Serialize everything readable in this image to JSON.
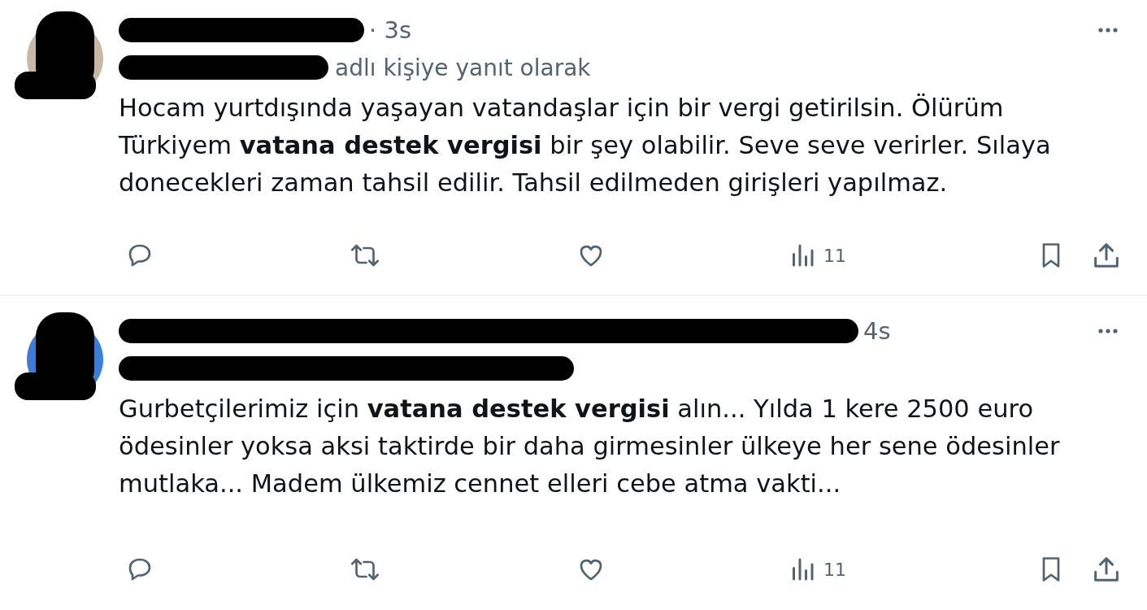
{
  "tweets": [
    {
      "time": "· 3s",
      "reply_note": "adlı kişiye yanıt olarak",
      "text": "Hocam yurtdışında yaşayan vatandaşlar için bir vergi getirilsin. Ölürüm Türkiyem **vatana destek vergisi** bir şey olabilir. Seve seve verirler. Sılaya donecekleri zaman tahsil edilir. Tahsil edilmeden girişleri yapılmaz.",
      "views": "11"
    },
    {
      "time": "4s",
      "text": "Gurbetçilerimiz için **vatana destek vergisi** alın... Yılda 1 kere 2500 euro ödesinler yoksa aksi taktirde bir daha girmesinler ülkeye her sene ödesinler mutlaka... Madem ülkemiz cennet elleri cebe atma vakti...",
      "views": "11"
    }
  ]
}
